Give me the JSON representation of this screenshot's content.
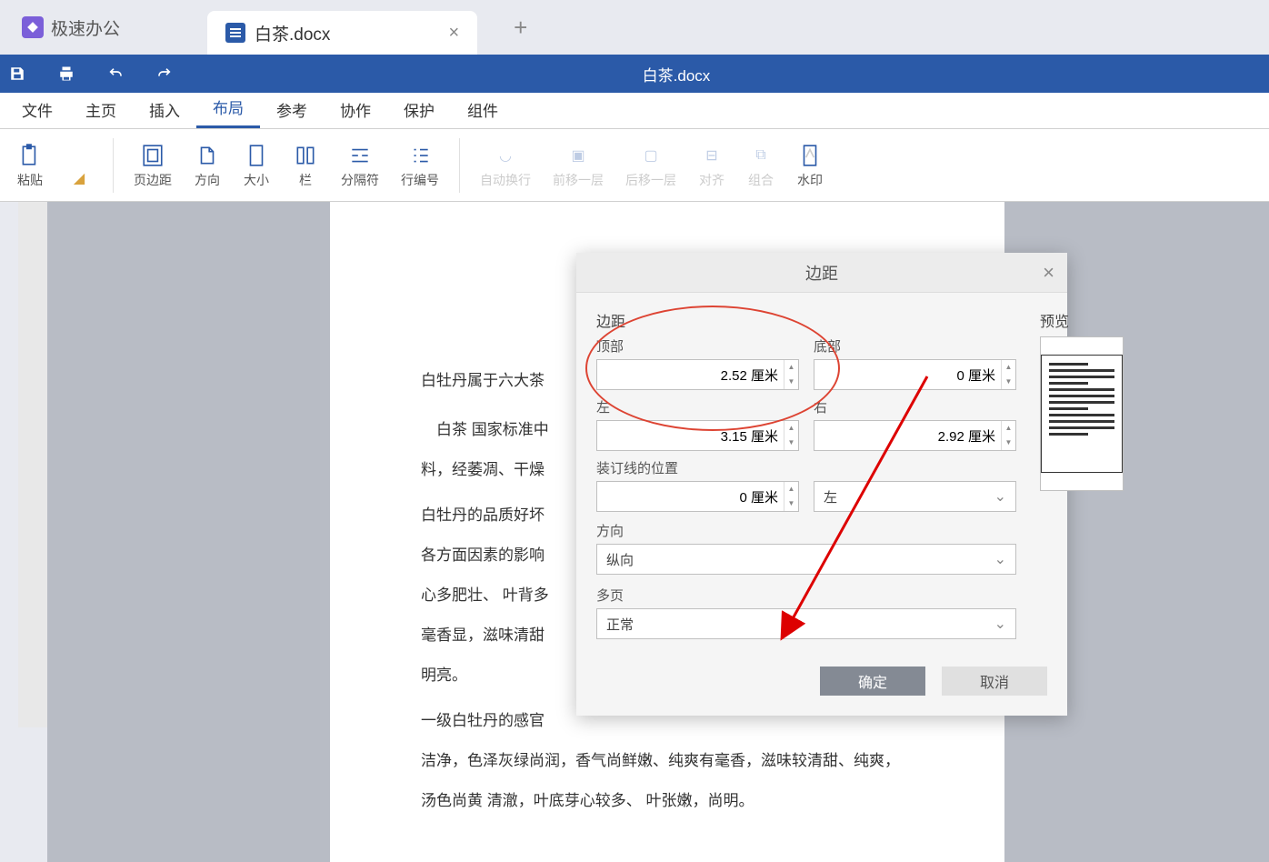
{
  "app": {
    "name": "极速办公"
  },
  "tab": {
    "name": "白茶.docx"
  },
  "title": "白茶.docx",
  "menu": {
    "items": [
      "文件",
      "主页",
      "插入",
      "布局",
      "参考",
      "协作",
      "保护",
      "组件"
    ],
    "active_index": 3
  },
  "ribbon": {
    "paste": "粘贴",
    "margins": "页边距",
    "orientation": "方向",
    "size": "大小",
    "columns": "栏",
    "breaks": "分隔符",
    "line_numbers": "行编号",
    "auto_wrap": "自动换行",
    "bring_forward": "前移一层",
    "send_backward": "后移一层",
    "align": "对齐",
    "group": "组合",
    "watermark": "水印"
  },
  "document": {
    "p1": "白牡丹属于六大茶",
    "p2a": "白茶  国家标准中",
    "p2b": "料，经萎凋、干燥",
    "p3a": "白牡丹的品质好坏",
    "p3b": "各方面因素的影响",
    "p3c": "心多肥壮、  叶背多",
    "p3d": "毫香显，滋味清甜",
    "p3e": "明亮。",
    "p4a": "一级白牡丹的感官",
    "p4b": "洁净，色泽灰绿尚润，香气尚鲜嫩、纯爽有毫香，滋味较清甜、纯爽，",
    "p4c": "汤色尚黄  清澈，叶底芽心较多、  叶张嫩，尚明。"
  },
  "dialog": {
    "title": "边距",
    "section_margins": "边距",
    "top_label": "顶部",
    "bottom_label": "底部",
    "left_label": "左",
    "right_label": "右",
    "gutter_label": "装订线的位置",
    "orientation_label": "方向",
    "multipage_label": "多页",
    "preview_label": "预览",
    "top_value": "2.52 厘米",
    "bottom_value": "0 厘米",
    "left_value": "3.15 厘米",
    "right_value": "2.92 厘米",
    "gutter_value": "0 厘米",
    "gutter_pos": "左",
    "orientation_value": "纵向",
    "multipage_value": "正常",
    "ok": "确定",
    "cancel": "取消"
  }
}
